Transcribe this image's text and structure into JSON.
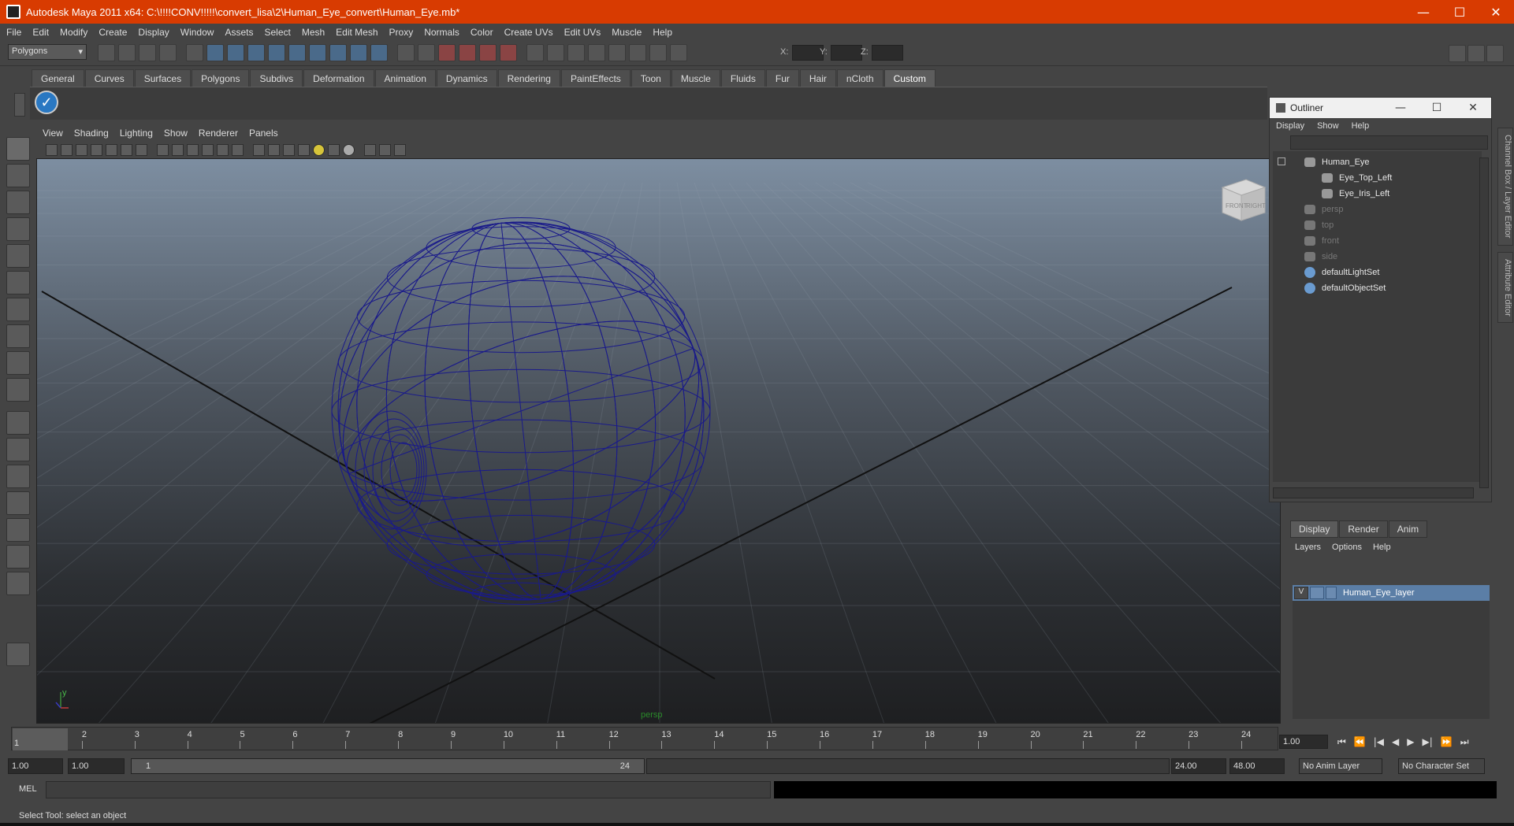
{
  "window": {
    "title": "Autodesk Maya 2011 x64: C:\\!!!!CONV!!!!!\\convert_lisa\\2\\Human_Eye_convert\\Human_Eye.mb*",
    "minimize": "—",
    "maximize": "☐",
    "close": "✕"
  },
  "menubar": [
    "File",
    "Edit",
    "Modify",
    "Create",
    "Display",
    "Window",
    "Assets",
    "Select",
    "Mesh",
    "Edit Mesh",
    "Proxy",
    "Normals",
    "Color",
    "Create UVs",
    "Edit UVs",
    "Muscle",
    "Help"
  ],
  "statusline": {
    "mode": "Polygons",
    "x_label": "X:",
    "y_label": "Y:",
    "z_label": "Z:"
  },
  "shelf": {
    "tabs": [
      "General",
      "Curves",
      "Surfaces",
      "Polygons",
      "Subdivs",
      "Deformation",
      "Animation",
      "Dynamics",
      "Rendering",
      "PaintEffects",
      "Toon",
      "Muscle",
      "Fluids",
      "Fur",
      "Hair",
      "nCloth",
      "Custom"
    ],
    "active": "Custom"
  },
  "viewport": {
    "menu": [
      "View",
      "Shading",
      "Lighting",
      "Show",
      "Renderer",
      "Panels"
    ],
    "camera": "persp",
    "viewcube": {
      "front": "FRONT",
      "right": "RIGHT"
    },
    "axis": {
      "y": "y",
      "x": "x"
    }
  },
  "outliner": {
    "title": "Outliner",
    "menu": [
      "Display",
      "Show",
      "Help"
    ],
    "items": [
      {
        "label": "Human_Eye",
        "dim": false
      },
      {
        "label": "Eye_Top_Left",
        "dim": false
      },
      {
        "label": "Eye_Iris_Left",
        "dim": false
      },
      {
        "label": "persp",
        "dim": true
      },
      {
        "label": "top",
        "dim": true
      },
      {
        "label": "front",
        "dim": true
      },
      {
        "label": "side",
        "dim": true
      },
      {
        "label": "defaultLightSet",
        "dim": false
      },
      {
        "label": "defaultObjectSet",
        "dim": false
      }
    ]
  },
  "sidetabs": {
    "channel": "Channel Box / Layer Editor",
    "attribute": "Attribute Editor"
  },
  "layer_editor": {
    "tabs": [
      "Display",
      "Render",
      "Anim"
    ],
    "active": "Display",
    "menu": [
      "Layers",
      "Options",
      "Help"
    ],
    "layer": {
      "visible": "V",
      "name": "Human_Eye_layer"
    }
  },
  "timeline": {
    "ticks": [
      "1",
      "2",
      "3",
      "4",
      "5",
      "6",
      "7",
      "8",
      "9",
      "10",
      "11",
      "12",
      "13",
      "14",
      "15",
      "16",
      "17",
      "18",
      "19",
      "20",
      "21",
      "22",
      "23",
      "24"
    ],
    "current_frame": "1",
    "frame_field": "1.00"
  },
  "playback": {
    "buttons": [
      "⏮",
      "⏪",
      "|◀",
      "◀",
      "▶",
      "▶|",
      "⏩",
      "⏭"
    ]
  },
  "range": {
    "start": "1.00",
    "playback_start": "1.00",
    "slider_start": "1",
    "slider_end": "24",
    "playback_end": "24.00",
    "end": "48.00",
    "anim_layer": "No Anim Layer",
    "character_set": "No Character Set"
  },
  "mel": {
    "label": "MEL"
  },
  "help_line": "Select Tool: select an object"
}
